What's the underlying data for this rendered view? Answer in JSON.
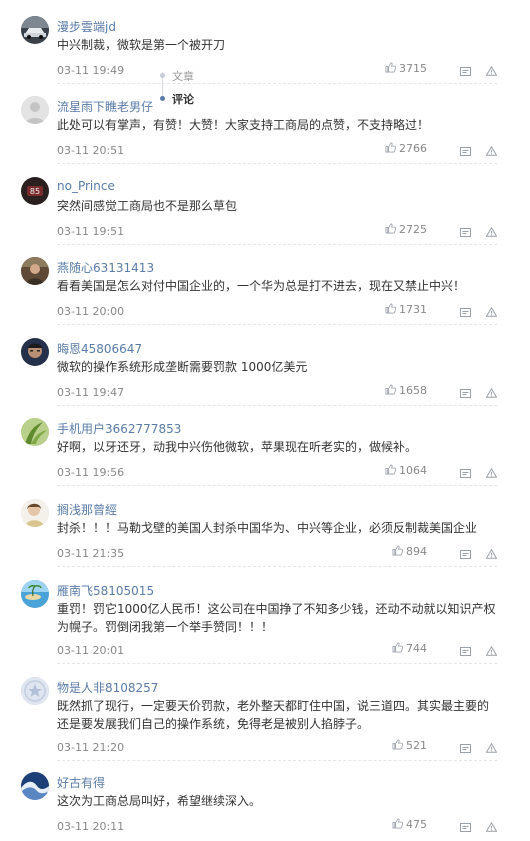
{
  "float_nav": {
    "article_label": "文章",
    "comments_label": "评论"
  },
  "comments": [
    {
      "user": "漫步雲端jd",
      "text": "中兴制裁，微软是第一个被开刀",
      "time": "03-11 19:49",
      "likes": "3715",
      "avatar_icon": "car-avatar-icon"
    },
    {
      "user": "流星雨下瞧老男仔",
      "text": "此处可以有掌声，有赞！大赞！大家支持工商局的点赞，不支持略过！",
      "time": "03-11 20:51",
      "likes": "2766",
      "avatar_icon": "default-avatar-icon"
    },
    {
      "user": "no_Prince",
      "text": "突然间感觉工商局也不是那么草包",
      "time": "03-11 19:51",
      "likes": "2725",
      "avatar_icon": "number-avatar-icon"
    },
    {
      "user": "燕随心63131413",
      "text": "看看美国是怎么对付中国企业的，一个华为总是打不进去，现在又禁止中兴！",
      "time": "03-11 20:00",
      "likes": "1731",
      "avatar_icon": "person-avatar-icon"
    },
    {
      "user": "晦恩45806647",
      "text": "微软的操作系统形成垄断需要罚款 1000亿美元",
      "time": "03-11 19:47",
      "likes": "1658",
      "avatar_icon": "face-avatar-icon"
    },
    {
      "user": "手机用户3662777853",
      "text": "好啊，以牙还牙，动我中兴伤他微软，苹果现在听老实的，做候补。",
      "time": "03-11 19:56",
      "likes": "1064",
      "avatar_icon": "plant-avatar-icon"
    },
    {
      "user": "搁浅那曾經",
      "text": "封杀！！！马勒戈壁的美国人封杀中国华为、中兴等企业，必须反制裁美国企业",
      "time": "03-11 21:35",
      "likes": "894",
      "avatar_icon": "boy-avatar-icon"
    },
    {
      "user": "雁南飞58105015",
      "text": "重罚！罚它1000亿人民币！这公司在中国挣了不知多少钱，还动不动就以知识产权为幌子。罚倒闭我第一个举手赞同！！！",
      "time": "03-11 20:01",
      "likes": "744",
      "avatar_icon": "island-avatar-icon"
    },
    {
      "user": "物是人非8108257",
      "text": "既然抓了现行，一定要天价罚款，老外整天都盯住中国，说三道四。其实最主要的还是要发展我们自己的操作系统，免得老是被别人掐脖子。",
      "time": "03-11 21:20",
      "likes": "521",
      "avatar_icon": "star-avatar-icon"
    },
    {
      "user": "好古有得",
      "text": "这次为工商总局叫好，希望继续深入。",
      "time": "03-11 20:11",
      "likes": "475",
      "avatar_icon": "wave-avatar-icon"
    }
  ],
  "colors": {
    "username": "#5a7ca7",
    "text": "#333333",
    "meta": "#888888"
  }
}
